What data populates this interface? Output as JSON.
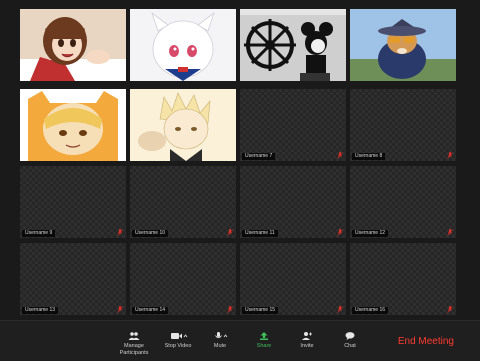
{
  "participants": [
    {
      "name": "",
      "type": "video",
      "picture": "anime-girl-brown-hair"
    },
    {
      "name": "",
      "type": "video",
      "picture": "anime-white-cat-girl"
    },
    {
      "name": "",
      "type": "video",
      "picture": "cartoon-mouse-steering-wheel"
    },
    {
      "name": "",
      "type": "video",
      "picture": "dog-in-hat-and-sunglasses"
    },
    {
      "name": "",
      "type": "video",
      "picture": "anime-character-orange-hood"
    },
    {
      "name": "",
      "type": "video",
      "picture": "anime-blond-boy-sketch"
    },
    {
      "name": "Username 7",
      "type": "empty",
      "muted": true
    },
    {
      "name": "Username 8",
      "type": "empty",
      "muted": true
    },
    {
      "name": "Username 9",
      "type": "empty",
      "muted": true
    },
    {
      "name": "Username 10",
      "type": "empty",
      "muted": true
    },
    {
      "name": "Username 11",
      "type": "empty",
      "muted": true
    },
    {
      "name": "Username 12",
      "type": "empty",
      "muted": true
    },
    {
      "name": "Username 13",
      "type": "empty",
      "muted": true
    },
    {
      "name": "Username 14",
      "type": "empty",
      "muted": true
    },
    {
      "name": "Username 15",
      "type": "empty",
      "muted": true
    },
    {
      "name": "Username 16",
      "type": "empty",
      "muted": true
    }
  ],
  "toolbar": {
    "manage_participants": {
      "line1": "Manage",
      "line2": "Participants",
      "icon": "participants-icon"
    },
    "stop_video": {
      "label": "Stop Video",
      "icon": "video-camera-icon"
    },
    "mute": {
      "label": "Mute",
      "icon": "microphone-icon"
    },
    "share": {
      "label": "Share",
      "icon": "share-arrow-icon",
      "color": "#3fbf5a"
    },
    "invite": {
      "label": "Invite",
      "icon": "add-person-icon"
    },
    "chat": {
      "label": "Chat",
      "icon": "chat-bubble-icon"
    },
    "end_meeting": {
      "label": "End Meeting",
      "color": "#ff3b30"
    }
  },
  "colors": {
    "background": "#1a1a1a",
    "tile": "#262626",
    "muted_red": "#e0302a"
  }
}
